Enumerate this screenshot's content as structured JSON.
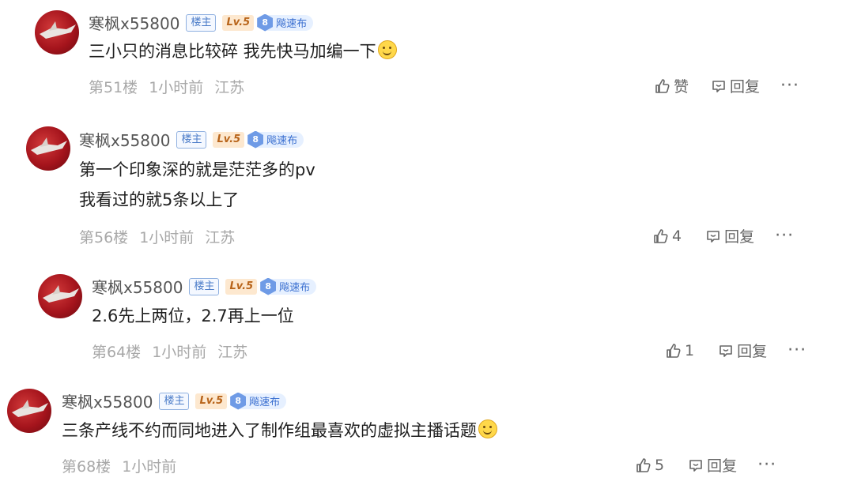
{
  "posts": [
    {
      "username": "寒枫x55800",
      "host_badge": "楼主",
      "level": "Lv.5",
      "fan_level": "8",
      "fan_badge": "飚速布",
      "lines": [
        "三小只的消息比较碎 我先快马加编一下"
      ],
      "emoji": "smile-emoji",
      "floor": "第51楼",
      "time": "1小时前",
      "location": "江苏",
      "like_label": "赞",
      "reply_label": "回复",
      "more": "···"
    },
    {
      "username": "寒枫x55800",
      "host_badge": "楼主",
      "level": "Lv.5",
      "fan_level": "8",
      "fan_badge": "飚速布",
      "lines": [
        "第一个印象深的就是茫茫多的pv",
        "我看过的就5条以上了"
      ],
      "floor": "第56楼",
      "time": "1小时前",
      "location": "江苏",
      "like_label": "4",
      "reply_label": "回复",
      "more": "···"
    },
    {
      "username": "寒枫x55800",
      "host_badge": "楼主",
      "level": "Lv.5",
      "fan_level": "8",
      "fan_badge": "飚速布",
      "lines": [
        "2.6先上两位，2.7再上一位"
      ],
      "floor": "第64楼",
      "time": "1小时前",
      "location": "江苏",
      "like_label": "1",
      "reply_label": "回复",
      "more": "···"
    },
    {
      "username": "寒枫x55800",
      "host_badge": "楼主",
      "level": "Lv.5",
      "fan_level": "8",
      "fan_badge": "飚速布",
      "lines": [
        "三条产线不约而同地进入了制作组最喜欢的虚拟主播话题"
      ],
      "emoji": "smile-emoji",
      "floor": "第68楼",
      "time": "1小时前",
      "location": "",
      "like_label": "5",
      "reply_label": "回复",
      "more": "···"
    }
  ]
}
